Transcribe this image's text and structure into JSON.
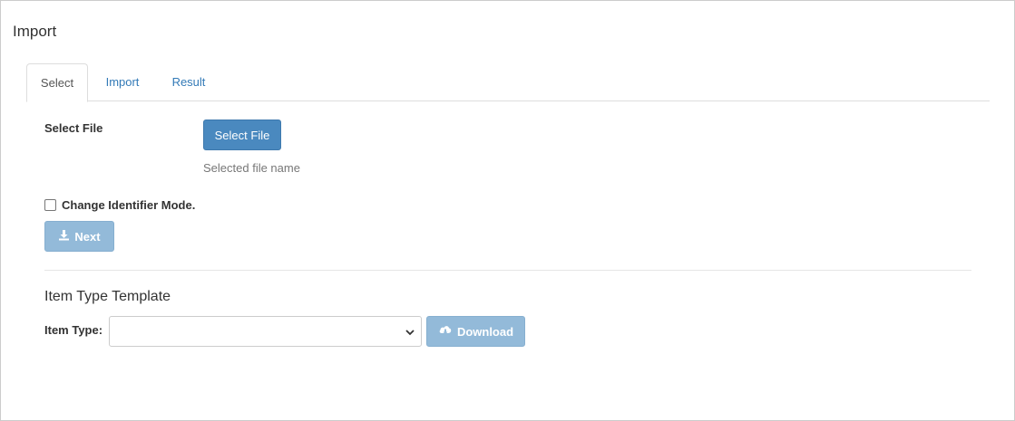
{
  "page": {
    "title": "Import"
  },
  "tabs": [
    {
      "label": "Select",
      "active": true
    },
    {
      "label": "Import",
      "active": false
    },
    {
      "label": "Result",
      "active": false
    }
  ],
  "select_file": {
    "label": "Select File",
    "button_label": "Select File",
    "file_name": "Selected file name"
  },
  "identifier_mode": {
    "label": "Change Identifier Mode.",
    "checked": false
  },
  "next_button": {
    "label": "Next",
    "icon": "download-icon",
    "disabled": true
  },
  "template": {
    "title": "Item Type Template",
    "item_type_label": "Item Type:",
    "item_type_value": "",
    "download_label": "Download",
    "download_icon": "cloud-download-icon",
    "disabled": true
  },
  "colors": {
    "primary": "#4a89bf",
    "primary_disabled": "#93bad9",
    "link": "#337ab7"
  }
}
